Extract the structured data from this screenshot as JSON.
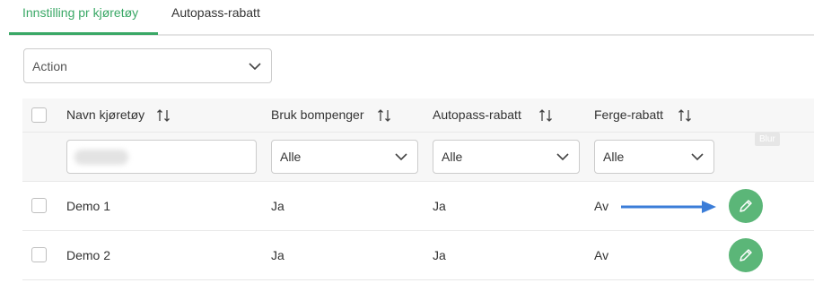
{
  "tabs": [
    {
      "label": "Innstilling pr kjøretøy",
      "active": true
    },
    {
      "label": "Autopass-rabatt",
      "active": false
    }
  ],
  "action_select": {
    "value": "Action"
  },
  "table": {
    "columns": [
      "Navn kjøretøy",
      "Bruk bompenger",
      "Autopass-rabatt",
      "Ferge-rabatt"
    ],
    "filters": {
      "name_value": "",
      "bruk_bompenger": "Alle",
      "autopass_rabatt": "Alle",
      "ferge_rabatt": "Alle"
    },
    "blur_badge": "Blur",
    "rows": [
      {
        "name": "Demo 1",
        "bruk_bompenger": "Ja",
        "autopass_rabatt": "Ja",
        "ferge_rabatt": "Av"
      },
      {
        "name": "Demo 2",
        "bruk_bompenger": "Ja",
        "autopass_rabatt": "Ja",
        "ferge_rabatt": "Av"
      }
    ]
  },
  "colors": {
    "accent": "#3aa866",
    "edit_button": "#5bb678",
    "annotation_arrow": "#3b7dd8"
  },
  "icons": {
    "sort": "sort-arrows-icon",
    "dropdown": "chevron-down-icon",
    "edit": "pencil-icon"
  }
}
